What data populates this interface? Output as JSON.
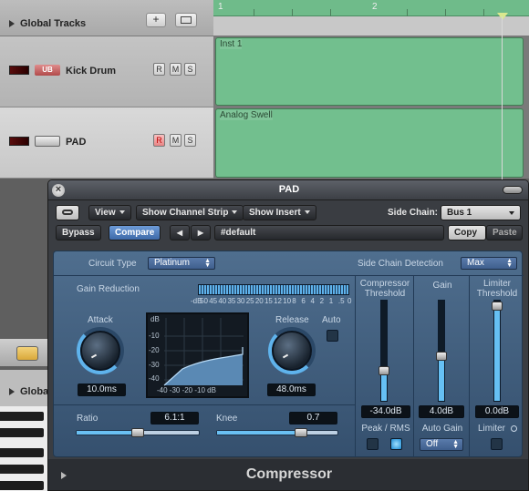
{
  "arrange": {
    "global_tracks_label": "Global Tracks",
    "add_button": "+",
    "ruler": [
      "1",
      "2"
    ],
    "tracks": [
      {
        "name": "Kick Drum",
        "instrument_badge": "UB",
        "r": "R",
        "m": "M",
        "s": "S",
        "region": "Inst 1"
      },
      {
        "name": "PAD",
        "instrument_badge": "",
        "r": "R",
        "m": "M",
        "s": "S",
        "region": "Analog Swell"
      }
    ],
    "bottom_global_label": "Global"
  },
  "plugin": {
    "title": "PAD",
    "toolbar": {
      "view": "View",
      "show_channel_strip": "Show Channel Strip",
      "show_insert": "Show Insert",
      "side_chain_label": "Side Chain:",
      "side_chain_value": "Bus 1"
    },
    "presetbar": {
      "bypass": "Bypass",
      "compare": "Compare",
      "prev": "◀",
      "next": "▶",
      "preset": "#default",
      "copy": "Copy",
      "paste": "Paste"
    },
    "compressor": {
      "circuit_type_label": "Circuit Type",
      "circuit_type_value": "Platinum",
      "side_chain_detection_label": "Side Chain Detection",
      "side_chain_detection_value": "Max",
      "gain_reduction_label": "Gain Reduction",
      "gr_scale": [
        "-dB",
        "50",
        "45",
        "40",
        "35",
        "30",
        "25",
        "20",
        "15",
        "12",
        "10",
        "8",
        "6",
        "4",
        "2",
        "1",
        ".5",
        "0"
      ],
      "attack_label": "Attack",
      "attack_value": "10.0ms",
      "release_label": "Release",
      "release_value": "48.0ms",
      "auto_label": "Auto",
      "graph_y": [
        "dB",
        "-10",
        "-20",
        "-30",
        "-40"
      ],
      "graph_x": "-40 -30 -20 -10 dB",
      "ratio_label": "Ratio",
      "ratio_value": "6.1:1",
      "ratio_fraction": 0.5,
      "knee_label": "Knee",
      "knee_value": "0.7",
      "knee_fraction": 0.7,
      "threshold_label_1": "Compressor",
      "threshold_label_2": "Threshold",
      "threshold_value": "-34.0dB",
      "threshold_fraction": 0.3,
      "gain_label": "Gain",
      "gain_value": "4.0dB",
      "gain_fraction": 0.45,
      "limiter_label_1": "Limiter",
      "limiter_label_2": "Threshold",
      "limiter_value": "0.0dB",
      "limiter_fraction": 0.95,
      "peak_rms_label": "Peak / RMS",
      "auto_gain_label": "Auto Gain",
      "auto_gain_value": "Off",
      "limiter_toggle_label": "Limiter",
      "plugin_name": "Compressor"
    }
  }
}
